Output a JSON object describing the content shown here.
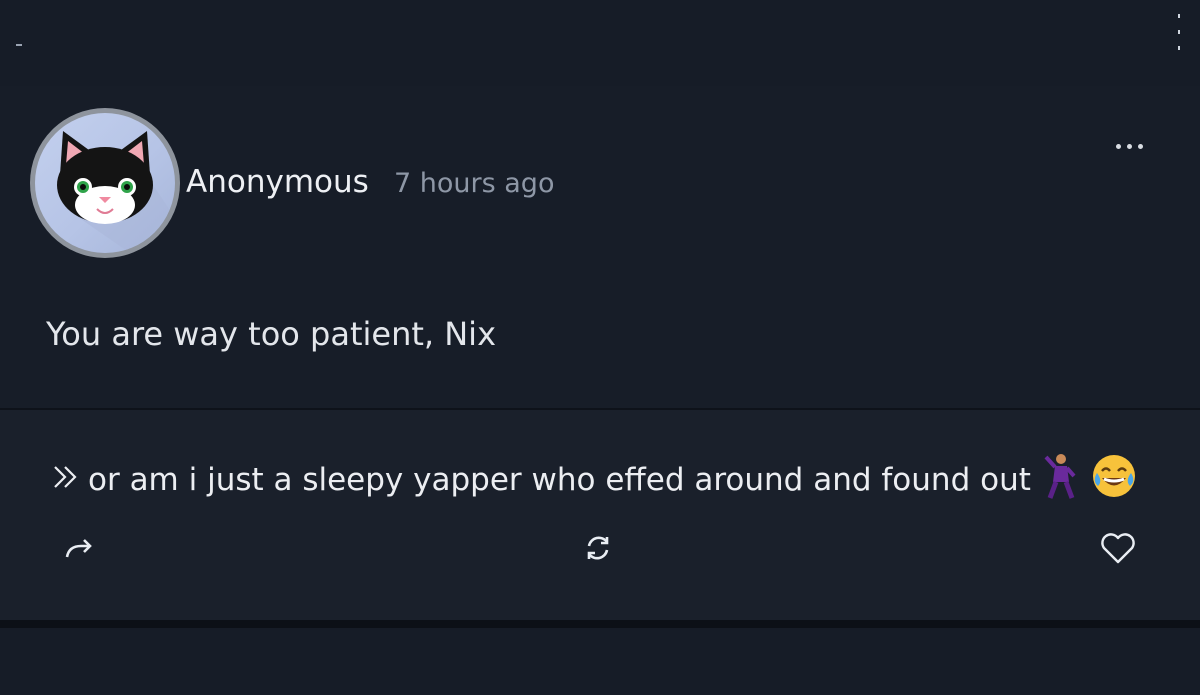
{
  "post": {
    "author": "Anonymous",
    "timestamp": "7 hours ago",
    "message": "You are way too patient, Nix",
    "avatar_icon": "cat-avatar-icon",
    "options_icon": "more-horizontal-icon"
  },
  "reply": {
    "prefix_icon": "double-chevron-right-icon",
    "text": "or am i just a sleepy yapper who effed around and found out",
    "emojis": [
      "dancing-man-emoji",
      "tears-of-joy-emoji"
    ]
  },
  "actions": {
    "share_icon": "share-arrow-icon",
    "repost_icon": "refresh-icon",
    "like_icon": "heart-outline-icon"
  },
  "colors": {
    "background": "#161c27",
    "reply_background": "#1a202b",
    "text_primary": "#eef0f4",
    "text_secondary": "#8e97a6"
  }
}
